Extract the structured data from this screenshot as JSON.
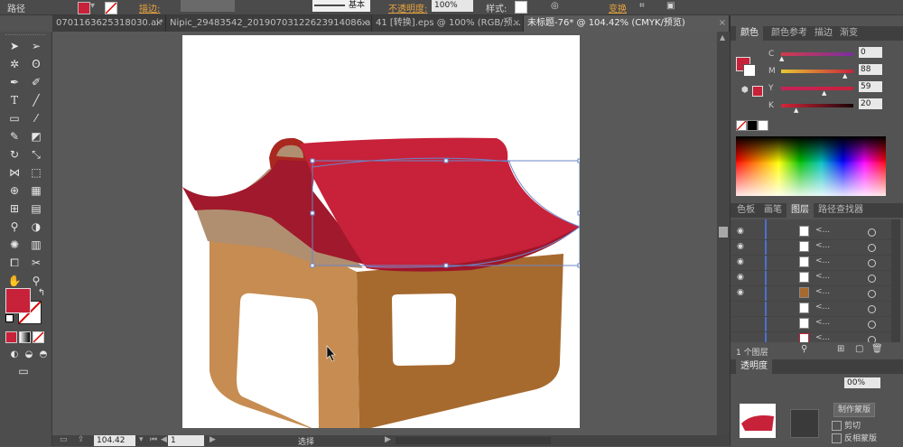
{
  "control_bar": {
    "object_type": "路径",
    "stroke_label": "描边:",
    "stroke_style": "基本",
    "opacity_label": "不透明度:",
    "opacity_value": "100%",
    "style_label": "样式:",
    "transform_label": "变换"
  },
  "tabs": [
    {
      "label": "0701163625318030.ai*",
      "active": false
    },
    {
      "label": "Nipic_29483542_20190703122623914086.ai*",
      "active": false
    },
    {
      "label": "41 [转换].eps @ 100% (RGB/预...",
      "active": false
    },
    {
      "label": "未标题-76* @ 104.42% (CMYK/预览)",
      "active": true
    }
  ],
  "tool_icons": [
    "selection-tool",
    "direct-selection-tool",
    "magic-wand-tool",
    "lasso-tool",
    "pen-tool",
    "curvature-tool",
    "type-tool",
    "line-tool",
    "rectangle-tool",
    "paintbrush-tool",
    "pencil-tool",
    "eraser-tool",
    "rotate-tool",
    "scale-tool",
    "width-tool",
    "free-transform-tool",
    "shape-builder-tool",
    "perspective-tool",
    "mesh-tool",
    "gradient-tool",
    "eyedropper-tool",
    "blend-tool",
    "symbol-sprayer-tool",
    "column-graph-tool",
    "artboard-tool",
    "slice-tool",
    "hand-tool",
    "zoom-tool"
  ],
  "fill_color": "#c8213a",
  "color_panel": {
    "tabs": [
      "颜色",
      "颜色参考",
      "描边",
      "渐变"
    ],
    "active_tab": "颜色",
    "channels": [
      {
        "label": "C",
        "value": "0",
        "position": 0.0
      },
      {
        "label": "M",
        "value": "88",
        "position": 0.88
      },
      {
        "label": "Y",
        "value": "59",
        "position": 0.59
      },
      {
        "label": "K",
        "value": "20",
        "position": 0.2
      }
    ]
  },
  "layers_panel": {
    "tabs": [
      "色板",
      "画笔",
      "图层",
      "路径查找器"
    ],
    "active_tab": "图层",
    "rows": [
      {
        "name": "<...",
        "visible": true
      },
      {
        "name": "<...",
        "visible": true
      },
      {
        "name": "<...",
        "visible": true
      },
      {
        "name": "<...",
        "visible": true
      },
      {
        "name": "<...",
        "visible": true
      },
      {
        "name": "<...",
        "visible": false
      },
      {
        "name": "<...",
        "visible": false
      },
      {
        "name": "<...",
        "visible": false
      }
    ],
    "footer": "1 个图层"
  },
  "transparency_panel": {
    "label": "透明度",
    "opacity": "00%",
    "make_mask_button": "制作蒙版",
    "clip_label": "剪切",
    "invert_mask_label": "反相蒙版"
  },
  "status_bar": {
    "zoom": "104.42",
    "page": "1",
    "tool_label": "选择"
  }
}
